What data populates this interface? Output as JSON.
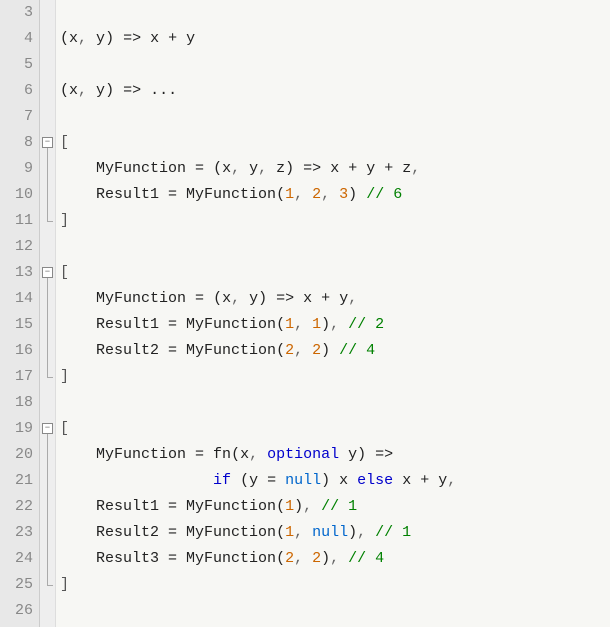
{
  "line_numbers": [
    "3",
    "4",
    "5",
    "6",
    "7",
    "8",
    "9",
    "10",
    "11",
    "12",
    "13",
    "14",
    "15",
    "16",
    "17",
    "18",
    "19",
    "20",
    "21",
    "22",
    "23",
    "24",
    "25",
    "26"
  ],
  "fold_regions": [
    {
      "start_index": 5,
      "end_index": 8
    },
    {
      "start_index": 10,
      "end_index": 14
    },
    {
      "start_index": 16,
      "end_index": 22
    }
  ],
  "code_lines": [
    {
      "tokens": []
    },
    {
      "tokens": [
        {
          "t": "(",
          "c": "op"
        },
        {
          "t": "x",
          "c": "id"
        },
        {
          "t": ", ",
          "c": "punct"
        },
        {
          "t": "y",
          "c": "id"
        },
        {
          "t": ") ",
          "c": "op"
        },
        {
          "t": "=>",
          "c": "op"
        },
        {
          "t": " x ",
          "c": "id"
        },
        {
          "t": "+",
          "c": "op"
        },
        {
          "t": " y",
          "c": "id"
        }
      ]
    },
    {
      "tokens": []
    },
    {
      "tokens": [
        {
          "t": "(",
          "c": "op"
        },
        {
          "t": "x",
          "c": "id"
        },
        {
          "t": ", ",
          "c": "punct"
        },
        {
          "t": "y",
          "c": "id"
        },
        {
          "t": ") ",
          "c": "op"
        },
        {
          "t": "=>",
          "c": "op"
        },
        {
          "t": " ",
          "c": "id"
        },
        {
          "t": "...",
          "c": "op"
        }
      ]
    },
    {
      "tokens": []
    },
    {
      "tokens": [
        {
          "t": "[",
          "c": "bracket"
        }
      ]
    },
    {
      "tokens": [
        {
          "t": "    MyFunction ",
          "c": "id"
        },
        {
          "t": "=",
          "c": "op"
        },
        {
          "t": " ",
          "c": "id"
        },
        {
          "t": "(",
          "c": "op"
        },
        {
          "t": "x",
          "c": "id"
        },
        {
          "t": ", ",
          "c": "punct"
        },
        {
          "t": "y",
          "c": "id"
        },
        {
          "t": ", ",
          "c": "punct"
        },
        {
          "t": "z",
          "c": "id"
        },
        {
          "t": ") ",
          "c": "op"
        },
        {
          "t": "=>",
          "c": "op"
        },
        {
          "t": " x ",
          "c": "id"
        },
        {
          "t": "+",
          "c": "op"
        },
        {
          "t": " y ",
          "c": "id"
        },
        {
          "t": "+",
          "c": "op"
        },
        {
          "t": " z",
          "c": "id"
        },
        {
          "t": ",",
          "c": "punct"
        }
      ]
    },
    {
      "tokens": [
        {
          "t": "    Result1 ",
          "c": "id"
        },
        {
          "t": "=",
          "c": "op"
        },
        {
          "t": " MyFunction",
          "c": "id"
        },
        {
          "t": "(",
          "c": "op"
        },
        {
          "t": "1",
          "c": "num"
        },
        {
          "t": ", ",
          "c": "punct"
        },
        {
          "t": "2",
          "c": "num"
        },
        {
          "t": ", ",
          "c": "punct"
        },
        {
          "t": "3",
          "c": "num"
        },
        {
          "t": ")",
          "c": "op"
        },
        {
          "t": " ",
          "c": "id"
        },
        {
          "t": "// 6",
          "c": "cmt"
        }
      ]
    },
    {
      "tokens": [
        {
          "t": "]",
          "c": "bracket"
        }
      ]
    },
    {
      "tokens": []
    },
    {
      "tokens": [
        {
          "t": "[",
          "c": "bracket"
        }
      ]
    },
    {
      "tokens": [
        {
          "t": "    MyFunction ",
          "c": "id"
        },
        {
          "t": "=",
          "c": "op"
        },
        {
          "t": " ",
          "c": "id"
        },
        {
          "t": "(",
          "c": "op"
        },
        {
          "t": "x",
          "c": "id"
        },
        {
          "t": ", ",
          "c": "punct"
        },
        {
          "t": "y",
          "c": "id"
        },
        {
          "t": ") ",
          "c": "op"
        },
        {
          "t": "=>",
          "c": "op"
        },
        {
          "t": " x ",
          "c": "id"
        },
        {
          "t": "+",
          "c": "op"
        },
        {
          "t": " y",
          "c": "id"
        },
        {
          "t": ",",
          "c": "punct"
        }
      ]
    },
    {
      "tokens": [
        {
          "t": "    Result1 ",
          "c": "id"
        },
        {
          "t": "=",
          "c": "op"
        },
        {
          "t": " MyFunction",
          "c": "id"
        },
        {
          "t": "(",
          "c": "op"
        },
        {
          "t": "1",
          "c": "num"
        },
        {
          "t": ", ",
          "c": "punct"
        },
        {
          "t": "1",
          "c": "num"
        },
        {
          "t": ")",
          "c": "op"
        },
        {
          "t": ", ",
          "c": "punct"
        },
        {
          "t": "// 2",
          "c": "cmt"
        }
      ]
    },
    {
      "tokens": [
        {
          "t": "    Result2 ",
          "c": "id"
        },
        {
          "t": "=",
          "c": "op"
        },
        {
          "t": " MyFunction",
          "c": "id"
        },
        {
          "t": "(",
          "c": "op"
        },
        {
          "t": "2",
          "c": "num"
        },
        {
          "t": ", ",
          "c": "punct"
        },
        {
          "t": "2",
          "c": "num"
        },
        {
          "t": ")",
          "c": "op"
        },
        {
          "t": " ",
          "c": "id"
        },
        {
          "t": "// 4",
          "c": "cmt"
        }
      ]
    },
    {
      "tokens": [
        {
          "t": "]",
          "c": "bracket"
        }
      ]
    },
    {
      "tokens": []
    },
    {
      "tokens": [
        {
          "t": "[",
          "c": "bracket"
        }
      ]
    },
    {
      "tokens": [
        {
          "t": "    MyFunction ",
          "c": "id"
        },
        {
          "t": "=",
          "c": "op"
        },
        {
          "t": " fn",
          "c": "id"
        },
        {
          "t": "(",
          "c": "op"
        },
        {
          "t": "x",
          "c": "id"
        },
        {
          "t": ", ",
          "c": "punct"
        },
        {
          "t": "optional",
          "c": "kw"
        },
        {
          "t": " y",
          "c": "id"
        },
        {
          "t": ") ",
          "c": "op"
        },
        {
          "t": "=>",
          "c": "op"
        }
      ]
    },
    {
      "tokens": [
        {
          "t": "                 ",
          "c": "id"
        },
        {
          "t": "if",
          "c": "kw"
        },
        {
          "t": " ",
          "c": "id"
        },
        {
          "t": "(",
          "c": "op"
        },
        {
          "t": "y ",
          "c": "id"
        },
        {
          "t": "=",
          "c": "op"
        },
        {
          "t": " ",
          "c": "id"
        },
        {
          "t": "null",
          "c": "null"
        },
        {
          "t": ")",
          "c": "op"
        },
        {
          "t": " x ",
          "c": "id"
        },
        {
          "t": "else",
          "c": "kw"
        },
        {
          "t": " x ",
          "c": "id"
        },
        {
          "t": "+",
          "c": "op"
        },
        {
          "t": " y",
          "c": "id"
        },
        {
          "t": ",",
          "c": "punct"
        }
      ]
    },
    {
      "tokens": [
        {
          "t": "    Result1 ",
          "c": "id"
        },
        {
          "t": "=",
          "c": "op"
        },
        {
          "t": " MyFunction",
          "c": "id"
        },
        {
          "t": "(",
          "c": "op"
        },
        {
          "t": "1",
          "c": "num"
        },
        {
          "t": ")",
          "c": "op"
        },
        {
          "t": ", ",
          "c": "punct"
        },
        {
          "t": "// 1",
          "c": "cmt"
        }
      ]
    },
    {
      "tokens": [
        {
          "t": "    Result2 ",
          "c": "id"
        },
        {
          "t": "=",
          "c": "op"
        },
        {
          "t": " MyFunction",
          "c": "id"
        },
        {
          "t": "(",
          "c": "op"
        },
        {
          "t": "1",
          "c": "num"
        },
        {
          "t": ", ",
          "c": "punct"
        },
        {
          "t": "null",
          "c": "null"
        },
        {
          "t": ")",
          "c": "op"
        },
        {
          "t": ", ",
          "c": "punct"
        },
        {
          "t": "// 1",
          "c": "cmt"
        }
      ]
    },
    {
      "tokens": [
        {
          "t": "    Result3 ",
          "c": "id"
        },
        {
          "t": "=",
          "c": "op"
        },
        {
          "t": " MyFunction",
          "c": "id"
        },
        {
          "t": "(",
          "c": "op"
        },
        {
          "t": "2",
          "c": "num"
        },
        {
          "t": ", ",
          "c": "punct"
        },
        {
          "t": "2",
          "c": "num"
        },
        {
          "t": ")",
          "c": "op"
        },
        {
          "t": ", ",
          "c": "punct"
        },
        {
          "t": "// 4",
          "c": "cmt"
        }
      ]
    },
    {
      "tokens": [
        {
          "t": "]",
          "c": "bracket"
        }
      ]
    },
    {
      "tokens": []
    }
  ]
}
